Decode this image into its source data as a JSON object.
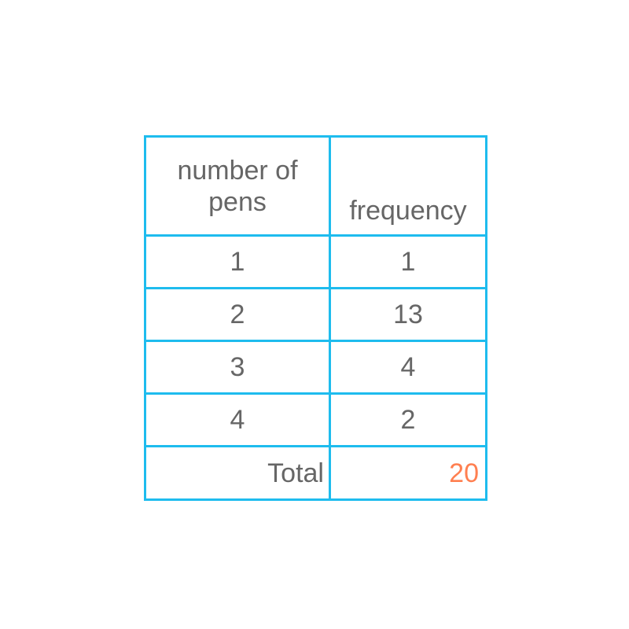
{
  "table": {
    "headers": [
      "number of pens",
      "frequency"
    ],
    "header_lines": [
      [
        "number of",
        "pens"
      ],
      [
        "frequency"
      ]
    ],
    "rows": [
      {
        "pens": "1",
        "frequency": "1"
      },
      {
        "pens": "2",
        "frequency": "13"
      },
      {
        "pens": "3",
        "frequency": "4"
      },
      {
        "pens": "4",
        "frequency": "2"
      }
    ],
    "total_label": "Total",
    "total_value": "20"
  },
  "colors": {
    "border": "#1ebcee",
    "text": "#666666",
    "total_value": "#ff7f50"
  },
  "chart_data": {
    "type": "table",
    "columns": [
      "number of pens",
      "frequency"
    ],
    "rows": [
      [
        1,
        1
      ],
      [
        2,
        13
      ],
      [
        3,
        4
      ],
      [
        4,
        2
      ]
    ],
    "total": 20
  }
}
